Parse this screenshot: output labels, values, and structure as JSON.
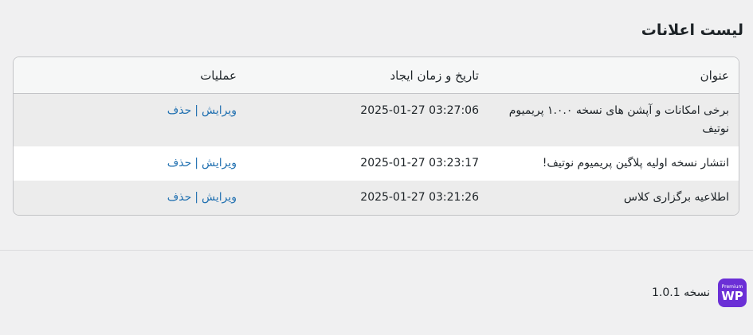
{
  "page": {
    "title": "لیست اعلانات"
  },
  "table": {
    "headers": {
      "title": "عنوان",
      "date": "تاریخ و زمان ایجاد",
      "operations": "عملیات"
    },
    "rows": [
      {
        "title": "برخی امکانات و آپشن های نسخه ۱.۰.۰ پریمیوم نوتیف",
        "date": "2025-01-27 03:27:06",
        "edit": "ویرایش",
        "delete": "حذف"
      },
      {
        "title": "انتشار نسخه اولیه پلاگین پریمیوم نوتیف!",
        "date": "2025-01-27 03:23:17",
        "edit": "ویرایش",
        "delete": "حذف"
      },
      {
        "title": "اطلاعیه برگزاری کلاس",
        "date": "2025-01-27 03:21:26",
        "edit": "ویرایش",
        "delete": "حذف"
      }
    ],
    "separator": "|"
  },
  "footer": {
    "logo_small": "Premium",
    "logo_main": "WP",
    "version_label": "نسخه",
    "version_number": "1.0.1"
  },
  "colors": {
    "link": "#2271b1",
    "logo_bg": "#6b2fd6"
  }
}
